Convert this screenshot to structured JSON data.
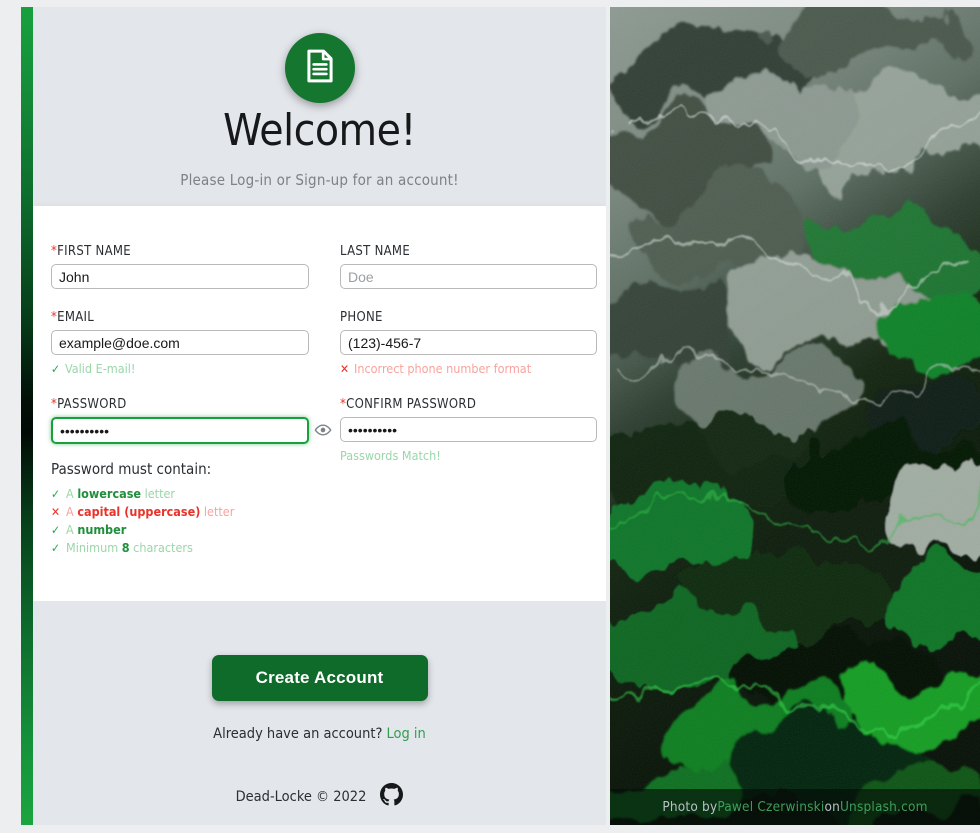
{
  "header": {
    "logo_icon": "document-icon",
    "title": "Welcome!",
    "subtitle": "Please Log-in or Sign-up for an account!"
  },
  "form": {
    "first_name": {
      "label": "FIRST NAME",
      "required_mark": "*",
      "value": "John",
      "placeholder": ""
    },
    "last_name": {
      "label": "LAST NAME",
      "required_mark": "",
      "value": "",
      "placeholder": "Doe"
    },
    "email": {
      "label": "EMAIL",
      "required_mark": "*",
      "value": "example@doe.com",
      "placeholder": "",
      "hint": "Valid E-mail!",
      "hint_icon": "check-icon",
      "hint_state": "ok"
    },
    "phone": {
      "label": "PHONE",
      "required_mark": "",
      "value": "(123)-456-7",
      "placeholder": "",
      "hint": "Incorrect phone number format",
      "hint_icon": "cross-icon",
      "hint_state": "bad"
    },
    "password": {
      "label": "PASSWORD",
      "required_mark": "*",
      "value": "••••••••••",
      "placeholder": "",
      "toggle_icon": "eye-icon"
    },
    "confirm_password": {
      "label": "CONFIRM PASSWORD",
      "required_mark": "*",
      "value": "••••••••••",
      "placeholder": "",
      "hint": "Passwords Match!",
      "hint_state": "ok"
    },
    "password_rules": {
      "title": "Password must contain:",
      "items": [
        {
          "state": "ok",
          "icon": "check-icon",
          "pre": "A ",
          "strong": "lowercase",
          "post": " letter"
        },
        {
          "state": "bad",
          "icon": "cross-icon",
          "pre": "A ",
          "strong": "capital (uppercase)",
          "post": " letter"
        },
        {
          "state": "ok",
          "icon": "check-icon",
          "pre": "A ",
          "strong": "number",
          "post": ""
        },
        {
          "state": "ok",
          "icon": "check-icon",
          "pre": "Minimum ",
          "strong": "8",
          "post": " characters"
        }
      ]
    }
  },
  "actions": {
    "submit_label": "Create Account",
    "have_account_text": "Already have an account? ",
    "login_link": "Log in"
  },
  "footer": {
    "copyright": "Dead-Locke © 2022",
    "github_icon": "github-icon"
  },
  "photo": {
    "credit_prefix": "Photo by ",
    "credit_author": "Pawel Czerwinski",
    "credit_mid": " on ",
    "credit_source": "Unsplash.com"
  },
  "colors": {
    "brand_green": "#0f6b2a",
    "accent_green": "#18a03c",
    "required_red": "#e8332a",
    "error_text": "#f7a39e",
    "success_text": "#9ad6a9",
    "header_bg": "#e3e6eb",
    "card_bg": "#ffffff"
  }
}
